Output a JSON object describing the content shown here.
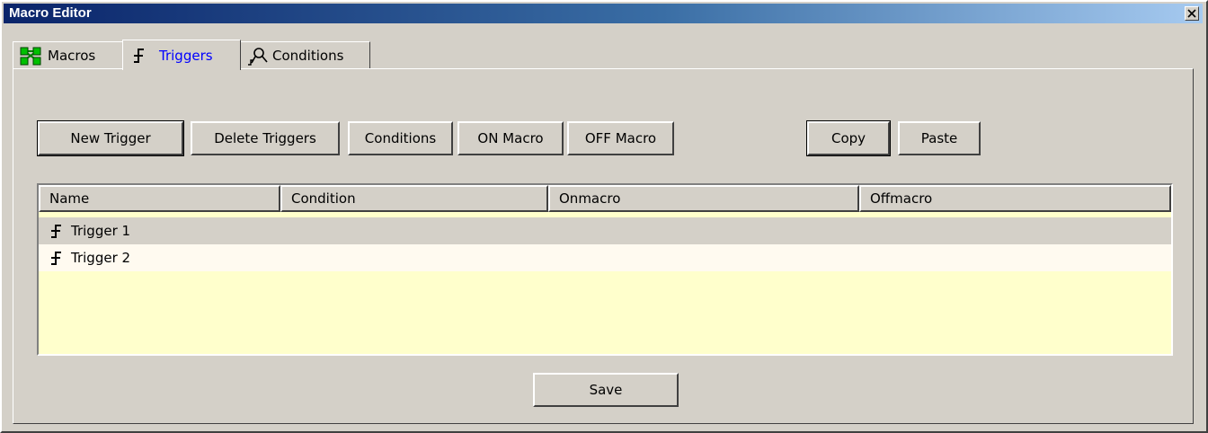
{
  "window": {
    "title": "Macro Editor"
  },
  "tabs": [
    {
      "label": "Macros",
      "icon": "macros-network-icon"
    },
    {
      "label": "Triggers",
      "icon": "trigger-icon"
    },
    {
      "label": "Conditions",
      "icon": "conditions-icon"
    }
  ],
  "toolbar": {
    "new_trigger": "New Trigger",
    "delete_triggers": "Delete Triggers",
    "conditions": "Conditions",
    "on_macro": "ON Macro",
    "off_macro": "OFF Macro",
    "copy": "Copy",
    "paste": "Paste"
  },
  "table": {
    "columns": [
      "Name",
      "Condition",
      "Onmacro",
      "Offmacro"
    ],
    "rows": [
      {
        "name": "Trigger 1",
        "condition": "",
        "onmacro": "",
        "offmacro": "",
        "selected": true
      },
      {
        "name": "Trigger 2",
        "condition": "",
        "onmacro": "",
        "offmacro": "",
        "selected": false
      }
    ]
  },
  "footer": {
    "save": "Save"
  },
  "colors": {
    "title_gradient_start": "#0a246a",
    "title_gradient_end": "#a6caf0",
    "list_background": "#ffffcc",
    "active_tab_text": "#0000ff"
  }
}
